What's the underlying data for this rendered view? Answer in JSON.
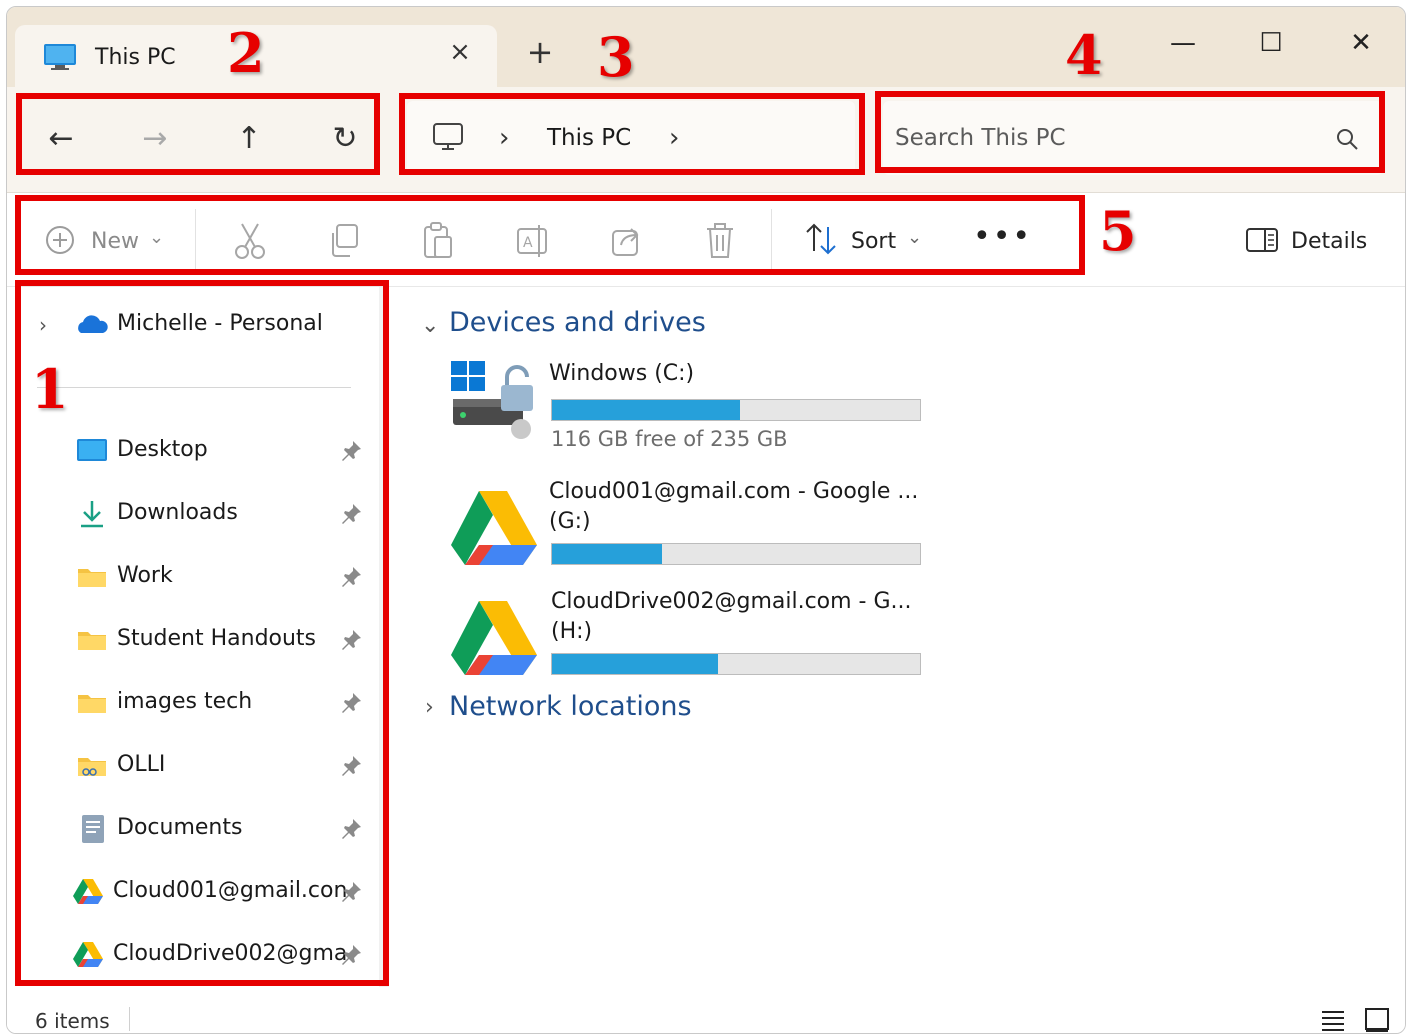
{
  "tab": {
    "title": "This PC",
    "close_glyph": "×",
    "new_tab_glyph": "+"
  },
  "window_controls": {
    "minimize": "—",
    "maximize": "☐",
    "close": "✕"
  },
  "nav": {
    "back": "←",
    "forward": "→",
    "up": "↑",
    "refresh": "↻"
  },
  "address": {
    "location": "This PC",
    "chevron": "›"
  },
  "search": {
    "placeholder": "Search This PC",
    "value": ""
  },
  "command_bar": {
    "new_label": "New",
    "sort_label": "Sort",
    "more_label": "•••",
    "details_label": "Details",
    "dropdown_chevron": "⌄"
  },
  "sidebar": {
    "onedrive": {
      "label": "Michelle - Personal",
      "expander": "›"
    },
    "items": [
      {
        "label": "Desktop",
        "icon": "desktop-folder-icon"
      },
      {
        "label": "Downloads",
        "icon": "download-icon"
      },
      {
        "label": "Work",
        "icon": "folder-icon"
      },
      {
        "label": "Student Handouts",
        "icon": "folder-icon"
      },
      {
        "label": "images tech",
        "icon": "folder-icon"
      },
      {
        "label": "OLLI",
        "icon": "folder-icon"
      },
      {
        "label": "Documents",
        "icon": "documents-icon"
      },
      {
        "label": "Cloud001@gmail.con",
        "icon": "google-drive-icon"
      },
      {
        "label": "CloudDrive002@gma",
        "icon": "google-drive-icon"
      }
    ]
  },
  "main": {
    "devices_header": "Devices and drives",
    "network_header": "Network locations",
    "drives": [
      {
        "name": "Windows (C:)",
        "free_text": "116 GB free of 235 GB",
        "used_fraction": 0.51
      },
      {
        "name": "Cloud001@gmail.com - Google ...",
        "letter": "(G:)",
        "used_fraction": 0.3
      },
      {
        "name": "CloudDrive002@gmail.com - G...",
        "letter": "(H:)",
        "used_fraction": 0.45
      }
    ]
  },
  "status": {
    "item_count": "6 items"
  },
  "annotations": [
    "1",
    "2",
    "3",
    "4",
    "5"
  ],
  "colors": {
    "accent": "#26a0da",
    "annotation": "#e60000",
    "header_blue": "#1f4e8c"
  }
}
